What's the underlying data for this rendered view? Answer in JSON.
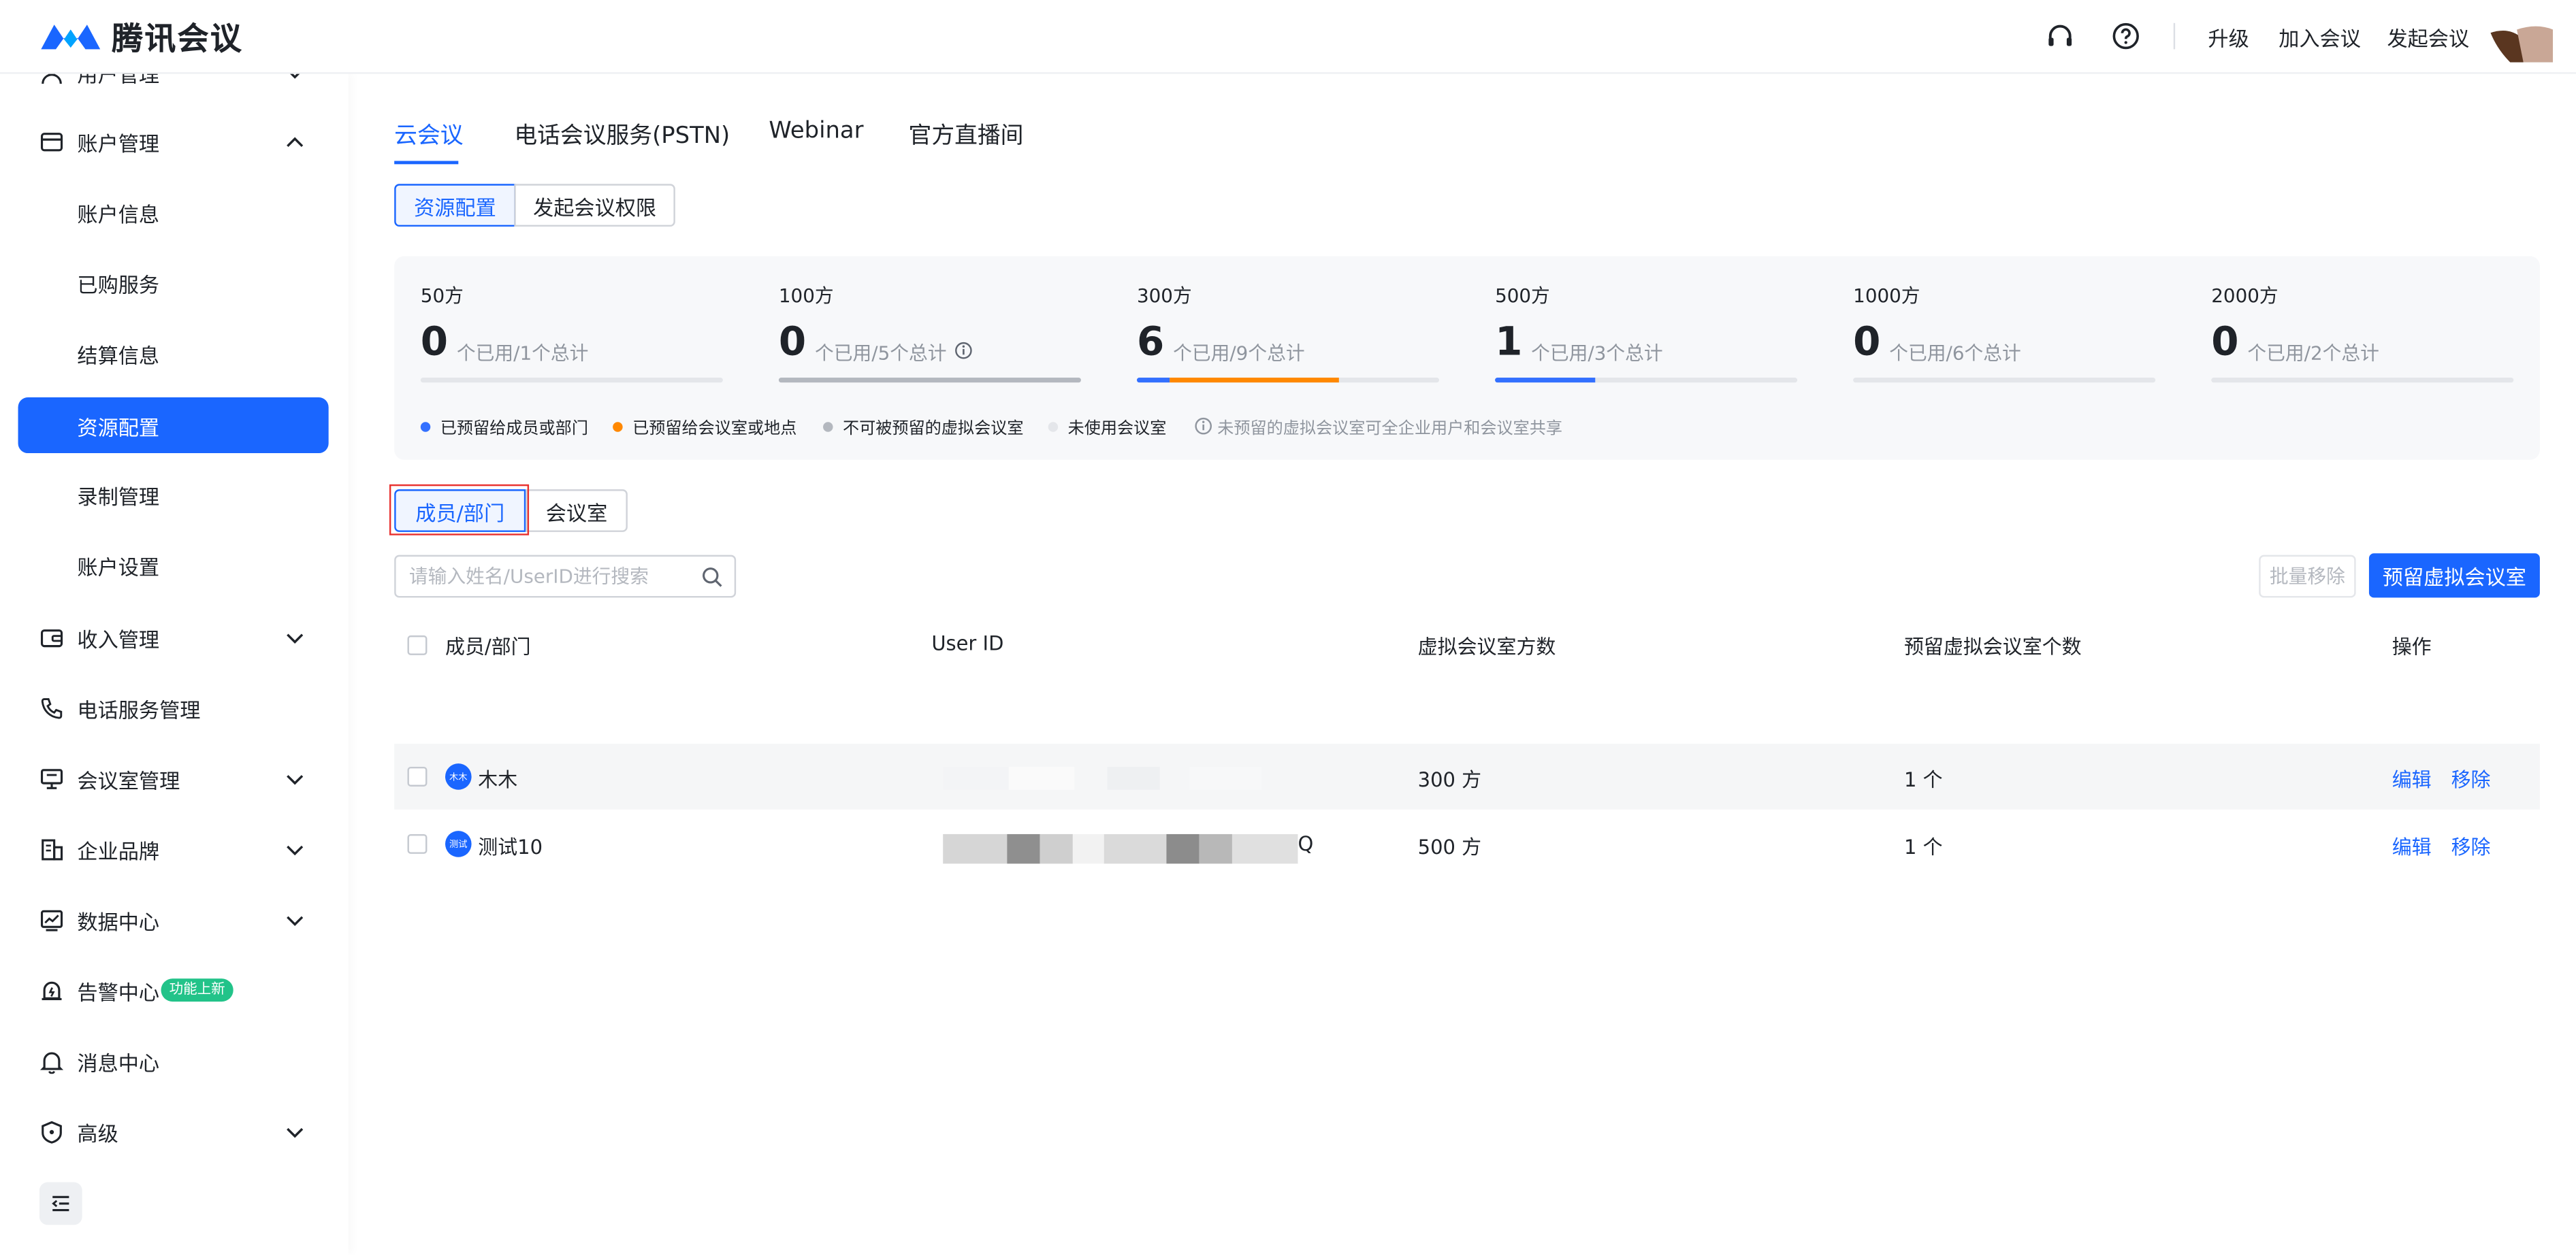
{
  "header": {
    "app_name": "腾讯会议",
    "links": {
      "upgrade": "升级",
      "join": "加入会议",
      "start": "发起会议"
    }
  },
  "sidebar": {
    "items": [
      {
        "label": "用户管理",
        "icon": "user-icon",
        "partial": true
      },
      {
        "label": "账户管理",
        "icon": "account-card-icon",
        "expanded": true
      },
      {
        "label": "账户信息",
        "sub": true
      },
      {
        "label": "已购服务",
        "sub": true
      },
      {
        "label": "结算信息",
        "sub": true
      },
      {
        "label": "资源配置",
        "sub": true,
        "active": true
      },
      {
        "label": "录制管理",
        "sub": true
      },
      {
        "label": "账户设置",
        "sub": true
      },
      {
        "label": "收入管理",
        "icon": "wallet-icon"
      },
      {
        "label": "电话服务管理",
        "icon": "phone-icon"
      },
      {
        "label": "会议室管理",
        "icon": "meeting-room-icon"
      },
      {
        "label": "企业品牌",
        "icon": "building-icon"
      },
      {
        "label": "数据中心",
        "icon": "chart-icon"
      },
      {
        "label": "告警中心",
        "icon": "alarm-icon",
        "badge": "功能上新"
      },
      {
        "label": "消息中心",
        "icon": "bell-icon"
      },
      {
        "label": "高级",
        "icon": "shield-icon"
      }
    ]
  },
  "main": {
    "tabs": [
      "云会议",
      "电话会议服务(PSTN)",
      "Webinar",
      "官方直播间"
    ],
    "active_tab": "云会议",
    "resource_tabs": [
      "资源配置",
      "发起会议权限"
    ],
    "stats": [
      {
        "title": "50方",
        "used": "0",
        "sub": "个已用/1个总计",
        "segments": []
      },
      {
        "title": "100方",
        "used": "0",
        "sub": "个已用/5个总计",
        "info": true,
        "segments": [
          {
            "color": "#b4b8bf",
            "fraction": 1.0
          }
        ]
      },
      {
        "title": "300方",
        "used": "6",
        "sub": "个已用/9个总计",
        "segments": [
          {
            "color": "#3370ff",
            "fraction": 0.111
          },
          {
            "color": "#ff8800",
            "fraction": 0.556
          }
        ]
      },
      {
        "title": "500方",
        "used": "1",
        "sub": "个已用/3个总计",
        "segments": [
          {
            "color": "#3370ff",
            "fraction": 0.333
          }
        ]
      },
      {
        "title": "1000方",
        "used": "0",
        "sub": "个已用/6个总计",
        "segments": []
      },
      {
        "title": "2000方",
        "used": "0",
        "sub": "个已用/2个总计",
        "segments": []
      }
    ],
    "legend": [
      {
        "label": "已预留给成员或部门",
        "color": "#3370ff"
      },
      {
        "label": "已预留给会议室或地点",
        "color": "#ff8800"
      },
      {
        "label": "不可被预留的虚拟会议室",
        "color": "#b4b8bf"
      },
      {
        "label": "未使用会议室",
        "color": "#e4e6ea"
      }
    ],
    "legend_note": "未预留的虚拟会议室可全企业用户和会议室共享",
    "member_tabs": [
      "成员/部门",
      "会议室"
    ],
    "search_placeholder": "请输入姓名/UserID进行搜索",
    "batch_remove": "批量移除",
    "reserve_button": "预留虚拟会议室",
    "table": {
      "headers": [
        "成员/部门",
        "User ID",
        "虚拟会议室方数",
        "预留虚拟会议室个数",
        "操作"
      ],
      "rows": [
        {
          "avatar": "木木",
          "name": "木木",
          "userid_suffix": "",
          "capacity": "300 方",
          "count": "1 个",
          "actions": [
            "编辑",
            "移除"
          ]
        },
        {
          "avatar": "测试",
          "name": "测试10",
          "userid_suffix": "Q",
          "capacity": "500 方",
          "count": "1 个",
          "actions": [
            "编辑",
            "移除"
          ]
        }
      ]
    }
  },
  "colors": {
    "accent": "#1a66ff",
    "highlight_box": "#e8312f",
    "badge": "#22c389"
  }
}
